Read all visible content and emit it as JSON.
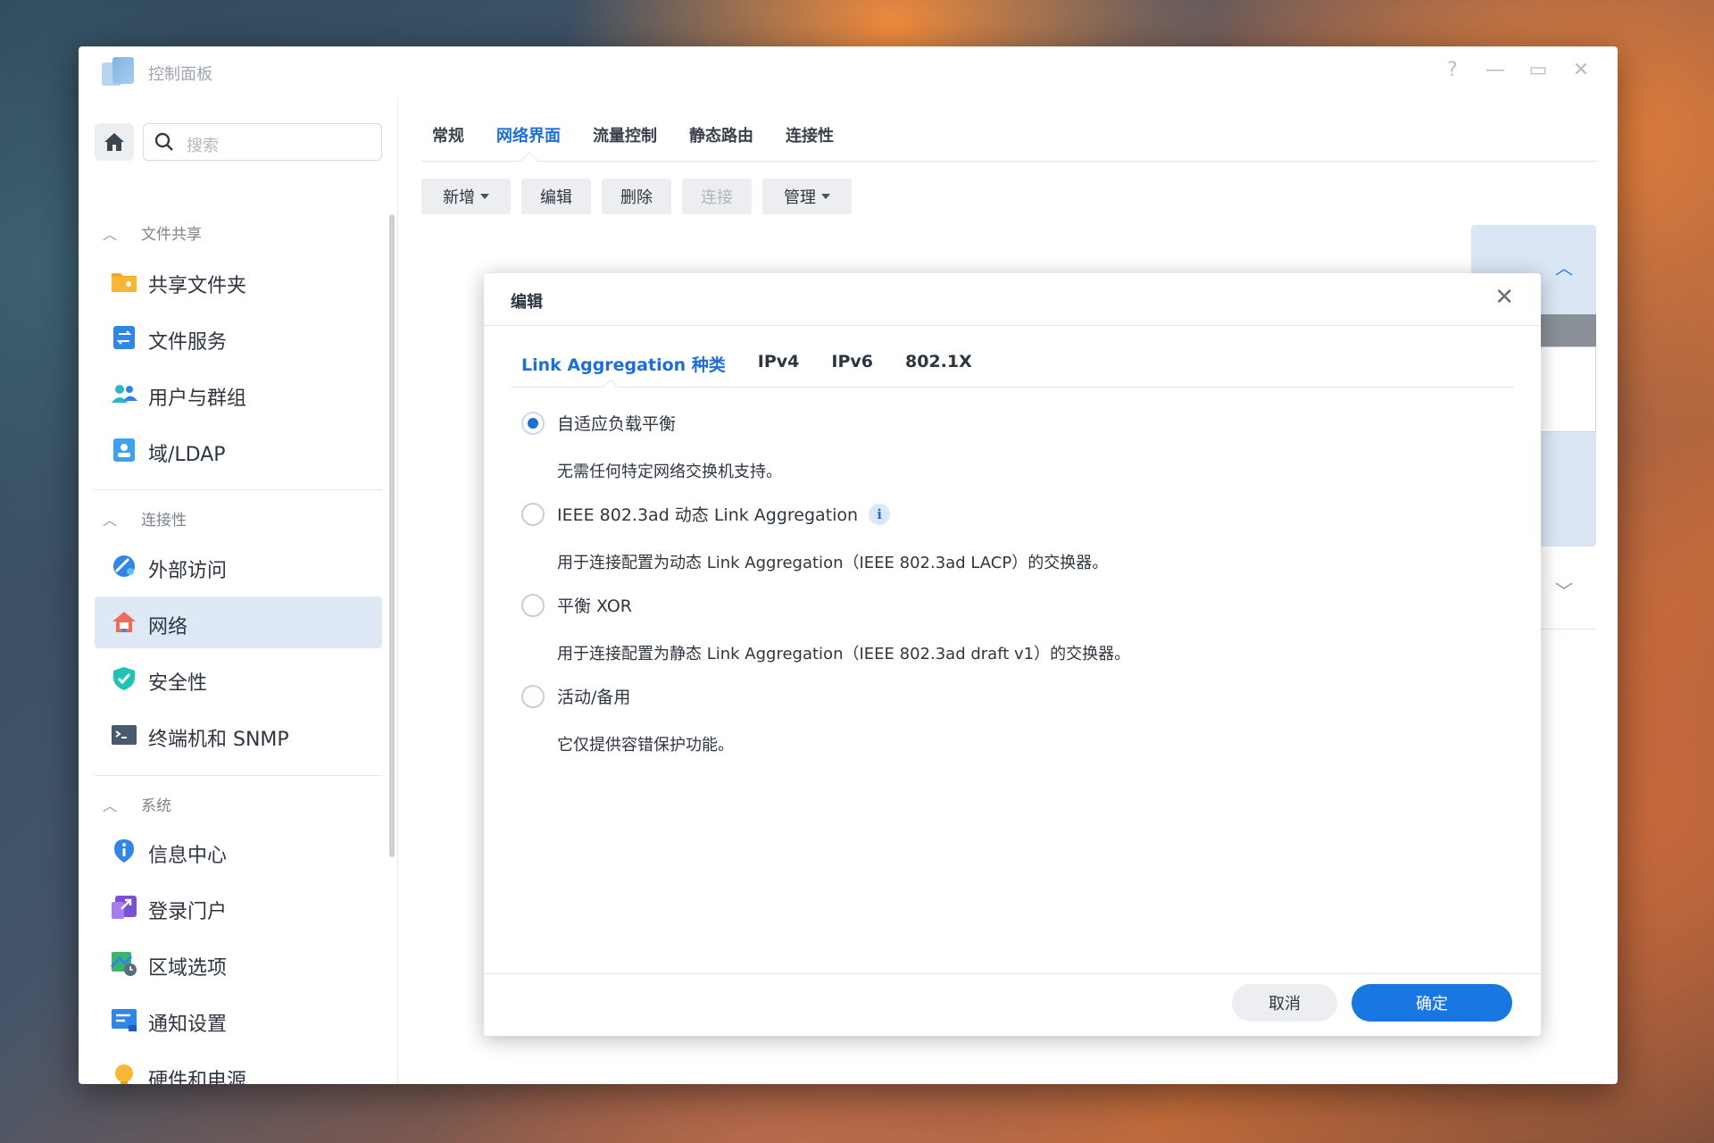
{
  "window": {
    "title": "控制面板",
    "controls": {
      "help": "?",
      "minimize": "—",
      "maximize": "▭",
      "close": "✕"
    }
  },
  "sidebar": {
    "search_placeholder": "搜索",
    "sections": [
      {
        "label": "文件共享",
        "items": [
          {
            "label": "共享文件夹",
            "icon": "folder-share-icon"
          },
          {
            "label": "文件服务",
            "icon": "file-services-icon"
          },
          {
            "label": "用户与群组",
            "icon": "users-icon"
          },
          {
            "label": "域/LDAP",
            "icon": "ldap-icon"
          }
        ]
      },
      {
        "label": "连接性",
        "items": [
          {
            "label": "外部访问",
            "icon": "external-access-icon"
          },
          {
            "label": "网络",
            "icon": "network-icon",
            "active": true
          },
          {
            "label": "安全性",
            "icon": "shield-icon"
          },
          {
            "label": "终端机和 SNMP",
            "icon": "terminal-icon"
          }
        ]
      },
      {
        "label": "系统",
        "items": [
          {
            "label": "信息中心",
            "icon": "info-center-icon"
          },
          {
            "label": "登录门户",
            "icon": "login-portal-icon"
          },
          {
            "label": "区域选项",
            "icon": "regional-options-icon"
          },
          {
            "label": "通知设置",
            "icon": "notification-icon"
          },
          {
            "label": "硬件和电源",
            "icon": "bulb-icon"
          }
        ]
      }
    ]
  },
  "main": {
    "tabs": [
      "常规",
      "网络界面",
      "流量控制",
      "静态路由",
      "连接性"
    ],
    "active_tab": "网络界面",
    "toolbar": {
      "add": "新增",
      "edit": "编辑",
      "delete": "删除",
      "connect": "连接",
      "manage": "管理"
    }
  },
  "dialog": {
    "title": "编辑",
    "tabs": [
      "Link Aggregation 种类",
      "IPv4",
      "IPv6",
      "802.1X"
    ],
    "active_tab": "Link Aggregation 种类",
    "options": [
      {
        "label": "自适应负载平衡",
        "desc": "无需任何特定网络交换机支持。",
        "checked": true
      },
      {
        "label": "IEEE 802.3ad 动态 Link Aggregation",
        "desc": "用于连接配置为动态 Link Aggregation（IEEE 802.3ad LACP）的交换器。",
        "checked": false,
        "info": "i"
      },
      {
        "label": "平衡 XOR",
        "desc": "用于连接配置为静态 Link Aggregation（IEEE 802.3ad draft v1）的交换器。",
        "checked": false
      },
      {
        "label": "活动/备用",
        "desc": "它仅提供容错保护功能。",
        "checked": false
      }
    ],
    "cancel_label": "取消",
    "ok_label": "确定"
  },
  "colors": {
    "accent": "#1877e0",
    "active_item_bg": "#dfe9f5"
  }
}
